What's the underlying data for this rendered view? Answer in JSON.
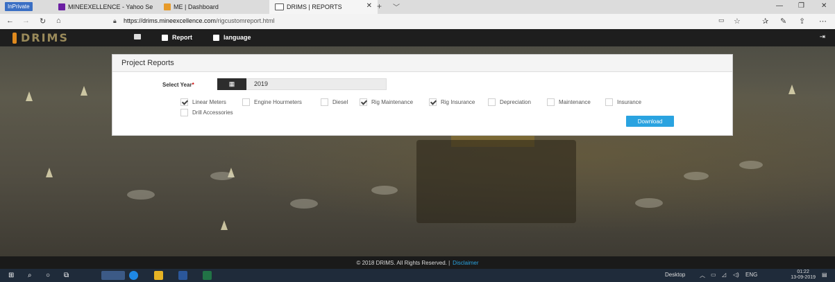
{
  "browser": {
    "tabs": [
      {
        "label": "InPrivate"
      },
      {
        "label": "MINEEXELLENCE - Yahoo Se"
      },
      {
        "label": "ME | Dashboard"
      },
      {
        "label": "DRIMS | REPORTS"
      }
    ],
    "new_tab": "+",
    "tab_menu": "﹀",
    "url_host": "https://drims.mineexcellence.com",
    "url_path": "/rigcustomreport.html"
  },
  "app": {
    "logo": "DRIMS",
    "nav": {
      "report": "Report",
      "language": "language"
    }
  },
  "panel": {
    "title": "Project Reports",
    "year_label": "Select Year",
    "year_required": "*",
    "year_value": "2019",
    "options": [
      {
        "label": "Linear Meters",
        "checked": true
      },
      {
        "label": "Engine Hourmeters",
        "checked": false
      },
      {
        "label": "Diesel",
        "checked": false
      },
      {
        "label": "Rig Maintenance",
        "checked": true
      },
      {
        "label": "Rig Insurance",
        "checked": true
      },
      {
        "label": "Depreciation",
        "checked": false
      },
      {
        "label": "Maintenance",
        "checked": false
      },
      {
        "label": "Insurance",
        "checked": false
      },
      {
        "label": "Drill Accessories",
        "checked": false
      }
    ],
    "download": "Download"
  },
  "footer": {
    "copyright": "© 2018 DRIMS. All Rights Reserved. |",
    "disclaimer": "Disclaimer"
  },
  "taskbar": {
    "desktop": "Desktop",
    "lang": "ENG",
    "time": "01:22",
    "date": "13-09-2019"
  }
}
